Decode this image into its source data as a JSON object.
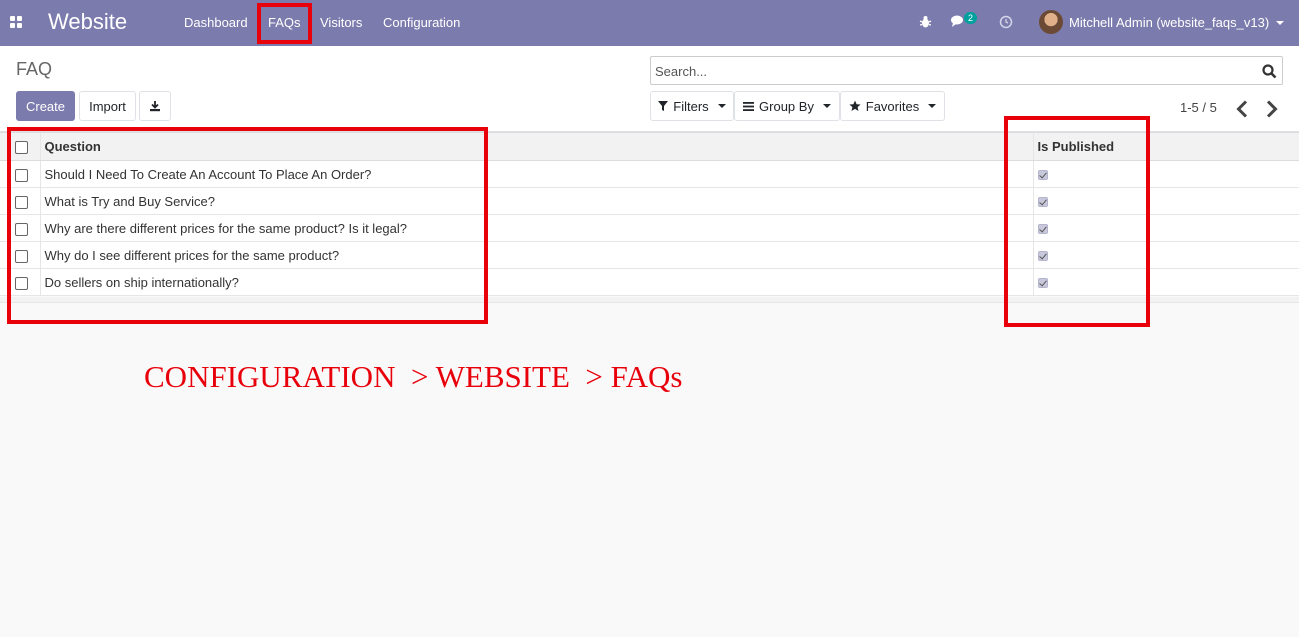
{
  "navbar": {
    "brand": "Website",
    "menu": [
      "Dashboard",
      "FAQs",
      "Visitors",
      "Configuration"
    ],
    "chat_count": "2",
    "user": "Mitchell Admin (website_faqs_v13)",
    "color": "#7c7bad"
  },
  "control_panel": {
    "title": "FAQ",
    "create_label": "Create",
    "import_label": "Import",
    "search_placeholder": "Search...",
    "filters_label": "Filters",
    "group_by_label": "Group By",
    "favorites_label": "Favorites",
    "pager": "1-5 / 5"
  },
  "list": {
    "columns": [
      "Question",
      "Is Published"
    ],
    "rows": [
      {
        "question": "Should I Need To Create An Account To Place An Order?",
        "published": true
      },
      {
        "question": "What is Try and Buy Service?",
        "published": true
      },
      {
        "question": "Why are there different prices for the same product? Is it legal?",
        "published": true
      },
      {
        "question": "Why do I see different prices for the same product?",
        "published": true
      },
      {
        "question": "Do sellers on ship internationally?",
        "published": true
      }
    ]
  },
  "annotation": {
    "text": "CONFIGURATION  > WEBSITE  > FAQs",
    "color": "#e8000b"
  },
  "icons": [
    "apps-icon",
    "bug-icon",
    "chat-icon",
    "clock-icon",
    "download-icon",
    "filter-icon",
    "bars-icon",
    "star-icon",
    "search-icon",
    "chevron-left-icon",
    "chevron-right-icon"
  ]
}
